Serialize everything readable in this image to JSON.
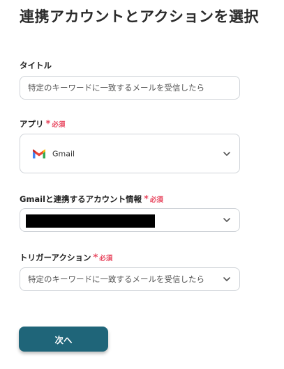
{
  "page": {
    "title": "連携アカウントとアクションを選択"
  },
  "form": {
    "title_field": {
      "label": "タイトル",
      "value": "特定のキーワードに一致するメールを受信したら"
    },
    "app_field": {
      "label": "アプリ",
      "required_mark": "*",
      "required_text": "必須",
      "value": "Gmail",
      "icon": "gmail-icon"
    },
    "account_field": {
      "label": "Gmailと連携するアカウント情報",
      "required_mark": "*",
      "required_text": "必須"
    },
    "trigger_field": {
      "label": "トリガーアクション",
      "required_mark": "*",
      "required_text": "必須",
      "value": "特定のキーワードに一致するメールを受信したら"
    }
  },
  "actions": {
    "next_label": "次へ"
  },
  "colors": {
    "accent": "#1f6579",
    "required": "#e8475f",
    "border": "#cfd3d8"
  }
}
